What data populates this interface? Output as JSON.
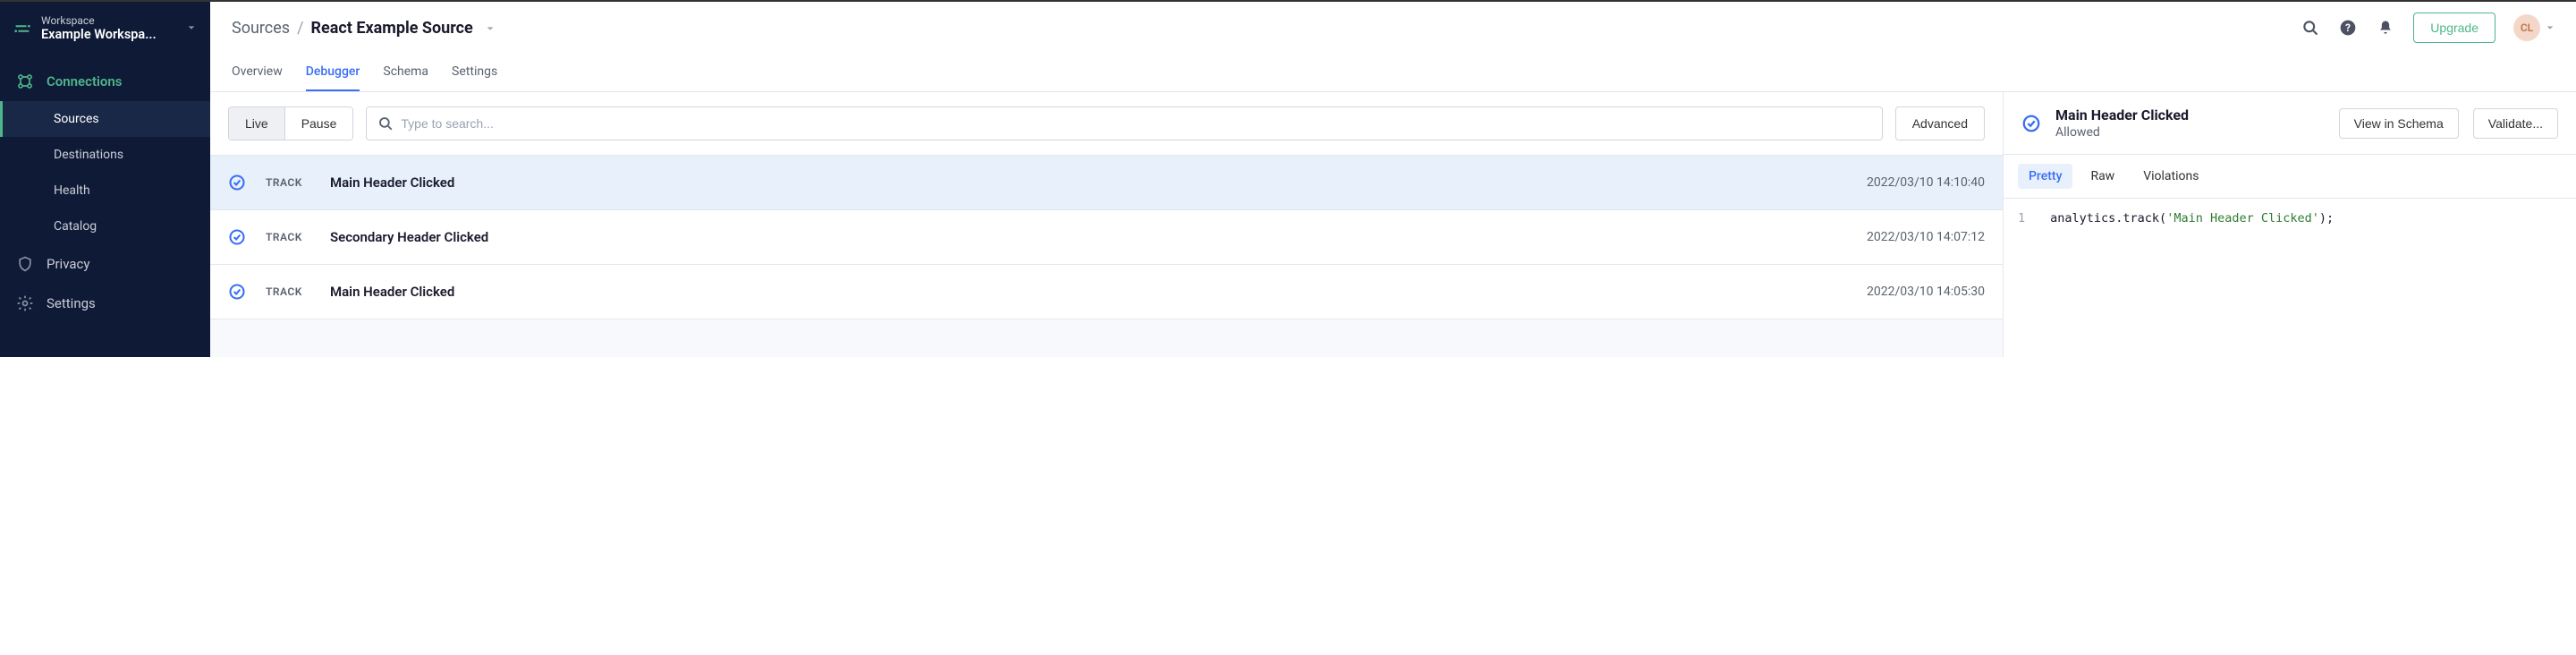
{
  "workspace": {
    "label": "Workspace",
    "name": "Example Workspa..."
  },
  "sidebar": {
    "items": [
      {
        "label": "Connections",
        "active": true
      },
      {
        "label": "Privacy"
      },
      {
        "label": "Settings"
      }
    ],
    "sub_items": [
      {
        "label": "Sources",
        "active": true
      },
      {
        "label": "Destinations"
      },
      {
        "label": "Health"
      },
      {
        "label": "Catalog"
      }
    ]
  },
  "breadcrumb": {
    "root": "Sources",
    "sep": "/",
    "current": "React Example Source"
  },
  "topbar": {
    "upgrade": "Upgrade",
    "avatar_initials": "CL"
  },
  "tabs": [
    {
      "label": "Overview"
    },
    {
      "label": "Debugger",
      "active": true
    },
    {
      "label": "Schema"
    },
    {
      "label": "Settings"
    }
  ],
  "controls": {
    "live": "Live",
    "pause": "Pause",
    "search_placeholder": "Type to search...",
    "advanced": "Advanced"
  },
  "events": [
    {
      "type": "TRACK",
      "name": "Main Header Clicked",
      "time": "2022/03/10 14:10:40",
      "selected": true
    },
    {
      "type": "TRACK",
      "name": "Secondary Header Clicked",
      "time": "2022/03/10 14:07:12"
    },
    {
      "type": "TRACK",
      "name": "Main Header Clicked",
      "time": "2022/03/10 14:05:30"
    }
  ],
  "detail": {
    "title": "Main Header Clicked",
    "status": "Allowed",
    "view_schema": "View in Schema",
    "validate": "Validate...",
    "tabs": [
      {
        "label": "Pretty",
        "active": true
      },
      {
        "label": "Raw"
      },
      {
        "label": "Violations"
      }
    ],
    "code": {
      "line_num": "1",
      "prefix": "analytics.track(",
      "string": "'Main Header Clicked'",
      "suffix": ");"
    }
  }
}
